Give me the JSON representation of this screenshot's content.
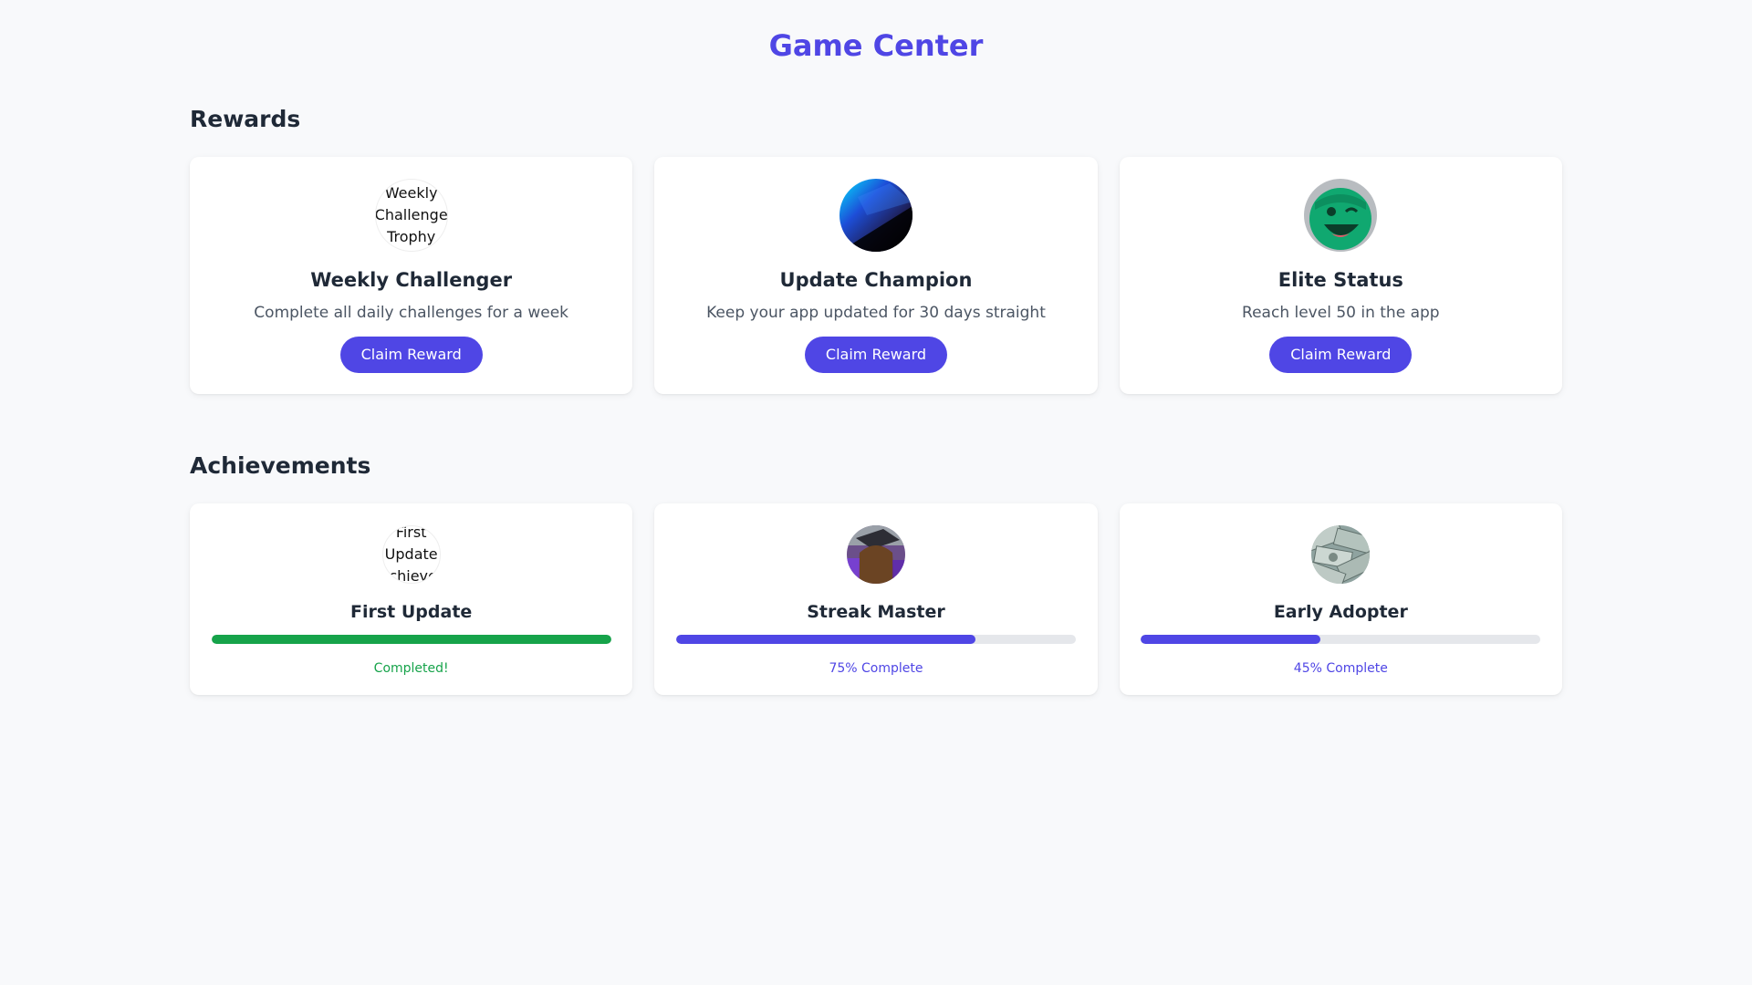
{
  "app": {
    "title": "Game Center"
  },
  "colors": {
    "accent": "#4f46e5",
    "success": "#16a34a",
    "track": "#e5e7eb"
  },
  "rewards": {
    "heading": "Rewards",
    "items": [
      {
        "title": "Weekly Challenger",
        "description": "Complete all daily challenges for a week",
        "image_alt": "Weekly Challenge Trophy",
        "button_label": "Claim Reward"
      },
      {
        "title": "Update Champion",
        "description": "Keep your app updated for 30 days straight",
        "button_label": "Claim Reward"
      },
      {
        "title": "Elite Status",
        "description": "Reach level 50 in the app",
        "button_label": "Claim Reward"
      }
    ]
  },
  "achievements": {
    "heading": "Achievements",
    "items": [
      {
        "title": "First Update",
        "image_alt": "First Update Achievement",
        "progress": 1.0,
        "status_text": "Completed!",
        "status_color": "#16a34a"
      },
      {
        "title": "Streak Master",
        "progress": 0.75,
        "status_text": "75% Complete",
        "status_color": "#4f46e5"
      },
      {
        "title": "Early Adopter",
        "progress": 0.45,
        "status_text": "45% Complete",
        "status_color": "#4f46e5"
      }
    ]
  }
}
